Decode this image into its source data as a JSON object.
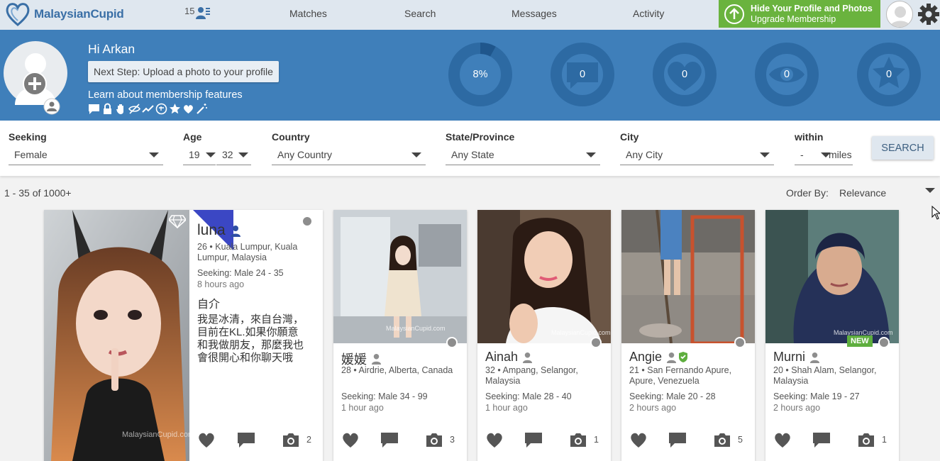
{
  "brand": {
    "name": "MalaysianCupid"
  },
  "nav": {
    "notif_count": "15",
    "links": [
      "Matches",
      "Search",
      "Messages",
      "Activity"
    ],
    "upgrade_line1": "Hide Your Profile and Photos",
    "upgrade_line2": "Upgrade Membership"
  },
  "hero": {
    "greeting": "Hi Arkan",
    "next_step": "Next Step: Upload a photo to your profile",
    "learn": "Learn about membership features",
    "profile_percent": "8%",
    "profile_fraction": 0.08,
    "stats": [
      {
        "icon": "message-icon",
        "value": "0"
      },
      {
        "icon": "heart-icon",
        "value": "0"
      },
      {
        "icon": "eye-icon",
        "value": "0"
      },
      {
        "icon": "star-icon",
        "value": "0"
      }
    ]
  },
  "search": {
    "seeking_label": "Seeking",
    "seeking_value": "Female",
    "age_label": "Age",
    "age_min": "19",
    "age_max": "32",
    "country_label": "Country",
    "country_value": "Any Country",
    "state_label": "State/Province",
    "state_value": "Any State",
    "city_label": "City",
    "city_value": "Any City",
    "within_label": "within",
    "within_value": "-",
    "within_unit": "miles",
    "button": "SEARCH"
  },
  "results": {
    "count": "1 - 35 of 1000+",
    "order_label": "Order By:",
    "order_value": "Relevance"
  },
  "profiles": [
    {
      "name": "luna",
      "details": "26 • Kuala Lumpur, Kuala Lumpur, Malaysia",
      "seeking": "Seeking: Male 24 - 35",
      "ago": "8 hours ago",
      "bio_heading": "自介",
      "bio": "我是冰清，來自台灣，目前在KL.如果你願意和我做朋友，那麼我也會很開心和你聊天哦",
      "photos": "2",
      "watermark": "MalaysianCupid.com"
    },
    {
      "name": "媛媛",
      "details": "28 • Airdrie, Alberta, Canada",
      "seeking": "Seeking: Male 34 - 99",
      "ago": "1 hour ago",
      "photos": "3",
      "watermark": "MalaysianCupid.com"
    },
    {
      "name": "Ainah",
      "details": "32 • Ampang, Selangor, Malaysia",
      "seeking": "Seeking: Male 28 - 40",
      "ago": "1 hour ago",
      "photos": "1",
      "watermark": "MalaysianCupid.com"
    },
    {
      "name": "Angie",
      "details": "21 • San Fernando Apure, Apure, Venezuela",
      "seeking": "Seeking: Male 20 - 28",
      "ago": "2 hours ago",
      "photos": "5"
    },
    {
      "name": "Murni",
      "details": "20 • Shah Alam, Selangor, Malaysia",
      "seeking": "Seeking: Male 19 - 27",
      "ago": "2 hours ago",
      "photos": "1",
      "badge": "NEW",
      "watermark": "MalaysianCupid.com"
    }
  ],
  "colors": {
    "header_blue": "#3f7fba",
    "nav_bg": "#dfe7ef",
    "upgrade_green": "#6ab33e",
    "ring": "#2d6aa3",
    "premium_diamond": "#3b47c4",
    "verified_green": "#5eae3e"
  }
}
